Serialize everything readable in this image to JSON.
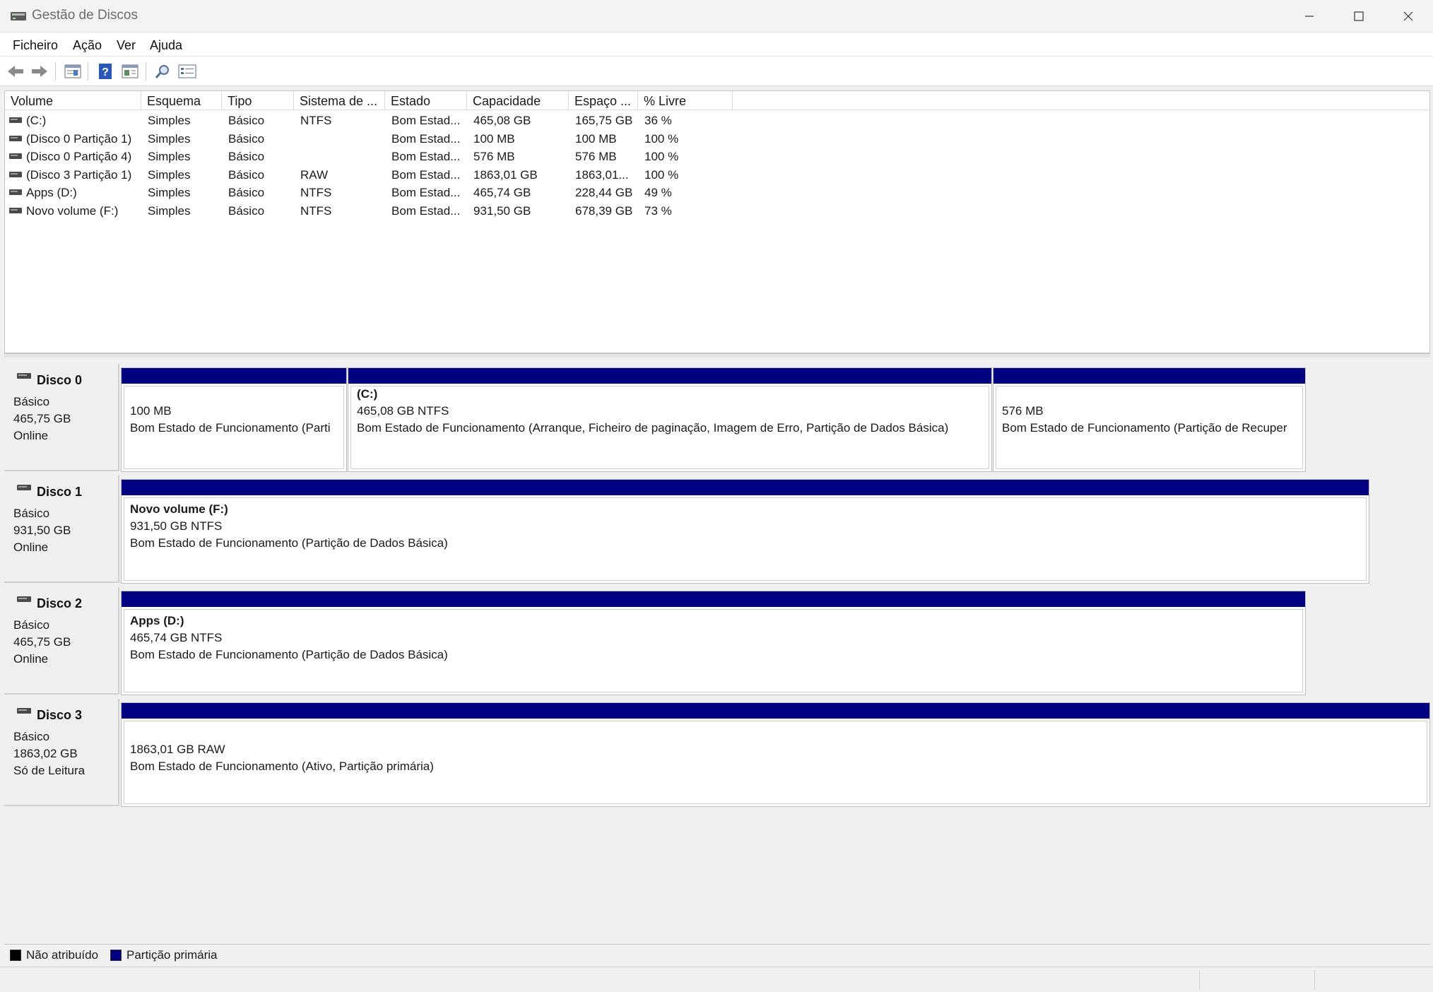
{
  "window": {
    "title": "Gestão de Discos"
  },
  "menu": {
    "items": [
      "Ficheiro",
      "Ação",
      "Ver",
      "Ajuda"
    ]
  },
  "toolbar": {
    "buttons": [
      "back-arrow-icon",
      "forward-arrow-icon",
      "disk-list-icon",
      "help-icon",
      "properties-panel-icon",
      "rescan-icon",
      "settings-list-icon"
    ]
  },
  "volume_list": {
    "columns": [
      "Volume",
      "Esquema",
      "Tipo",
      "Sistema de ...",
      "Estado",
      "Capacidade",
      "Espaço ...",
      "% Livre"
    ],
    "rows": [
      {
        "volume": " (C:)",
        "esquema": "Simples",
        "tipo": "Básico",
        "sistema": "NTFS",
        "estado": "Bom Estad...",
        "capacidade": "465,08 GB",
        "espaco": "165,75 GB",
        "livre": "36 %"
      },
      {
        "volume": "(Disco 0 Partição 1)",
        "esquema": "Simples",
        "tipo": "Básico",
        "sistema": "",
        "estado": "Bom Estad...",
        "capacidade": "100 MB",
        "espaco": "100 MB",
        "livre": "100 %"
      },
      {
        "volume": "(Disco 0 Partição 4)",
        "esquema": "Simples",
        "tipo": "Básico",
        "sistema": "",
        "estado": "Bom Estad...",
        "capacidade": "576 MB",
        "espaco": "576 MB",
        "livre": "100 %"
      },
      {
        "volume": "(Disco 3 Partição 1)",
        "esquema": "Simples",
        "tipo": "Básico",
        "sistema": "RAW",
        "estado": "Bom Estad...",
        "capacidade": "1863,01 GB",
        "espaco": "1863,01...",
        "livre": "100 %"
      },
      {
        "volume": "Apps (D:)",
        "esquema": "Simples",
        "tipo": "Básico",
        "sistema": "NTFS",
        "estado": "Bom Estad...",
        "capacidade": "465,74 GB",
        "espaco": "228,44 GB",
        "livre": "49 %"
      },
      {
        "volume": "Novo volume (F:)",
        "esquema": "Simples",
        "tipo": "Básico",
        "sistema": "NTFS",
        "estado": "Bom Estad...",
        "capacidade": "931,50 GB",
        "espaco": "678,39 GB",
        "livre": "73 %"
      }
    ]
  },
  "disks": [
    {
      "name": "Disco 0",
      "type": "Básico",
      "size": "465,75 GB",
      "status": "Online",
      "partitions": [
        {
          "title": "",
          "size": "100 MB",
          "status": "Bom Estado de Funcionamento (Parti"
        },
        {
          "title": " (C:)",
          "size": "465,08 GB NTFS",
          "status": "Bom Estado de Funcionamento (Arranque, Ficheiro de paginação, Imagem de Erro, Partição de Dados Básica)"
        },
        {
          "title": "",
          "size": "576 MB",
          "status": "Bom Estado de Funcionamento (Partição de Recuper"
        }
      ]
    },
    {
      "name": "Disco 1",
      "type": "Básico",
      "size": "931,50 GB",
      "status": "Online",
      "partitions": [
        {
          "title": "Novo volume  (F:)",
          "size": "931,50 GB NTFS",
          "status": "Bom Estado de Funcionamento (Partição de Dados Básica)"
        }
      ]
    },
    {
      "name": "Disco 2",
      "type": "Básico",
      "size": "465,75 GB",
      "status": "Online",
      "partitions": [
        {
          "title": "Apps  (D:)",
          "size": "465,74 GB NTFS",
          "status": "Bom Estado de Funcionamento (Partição de Dados Básica)"
        }
      ]
    },
    {
      "name": "Disco 3",
      "type": "Básico",
      "size": "1863,02 GB",
      "status": "Só de Leitura",
      "partitions": [
        {
          "title": "",
          "size": "1863,01 GB RAW",
          "status": "Bom Estado de Funcionamento (Ativo, Partição primária)"
        }
      ]
    }
  ],
  "legend": [
    {
      "label": "Não atribuído",
      "color": "#000000"
    },
    {
      "label": "Partição primária",
      "color": "#000080"
    }
  ]
}
